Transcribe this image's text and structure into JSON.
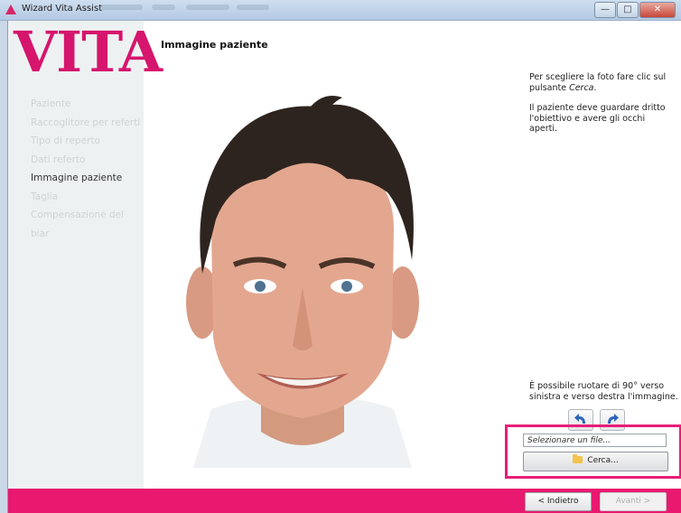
{
  "window": {
    "title": "Wizard Vita Assist",
    "controls": [
      "minimize",
      "maximize",
      "close"
    ]
  },
  "brand": {
    "logo": "VITA",
    "color": "#d6156d"
  },
  "sidebar": {
    "steps": [
      {
        "label": "Paziente",
        "active": false
      },
      {
        "label": "Raccoglitore per referti",
        "active": false
      },
      {
        "label": "Tipo di reperto",
        "active": false
      },
      {
        "label": "Dati referto",
        "active": false
      },
      {
        "label": "Immagine paziente",
        "active": true
      },
      {
        "label": "Taglia",
        "active": false
      },
      {
        "label": "Compensazione del biar",
        "active": false
      }
    ]
  },
  "main": {
    "title": "Immagine paziente",
    "instruction_1_text": "Per scegliere la foto fare clic sul pulsante ",
    "instruction_1_em": "Cerca",
    "instruction_1_end": ".",
    "instruction_2": "Il paziente deve guardare dritto l'obiettivo e avere gli occhi aperti.",
    "rotate_text": "È possibile ruotare di 90° verso sinistra e verso destra l'immagine.",
    "file_placeholder": "Selezionare un file...",
    "browse_label": "Cerca..."
  },
  "footer": {
    "back_label": "< Indietro",
    "next_label": "Avanti >",
    "accent": "#e8196f"
  }
}
